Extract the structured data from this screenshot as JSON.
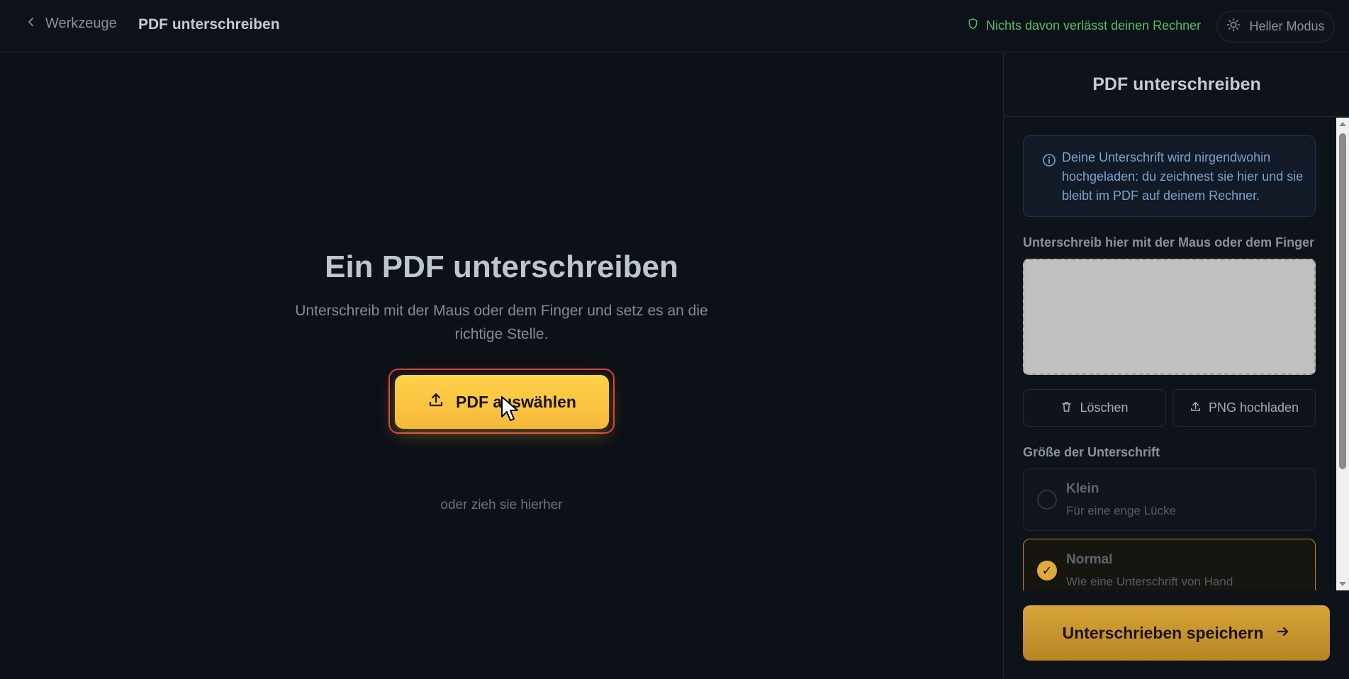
{
  "header": {
    "back_label": "Werkzeuge",
    "title": "PDF unterschreiben",
    "privacy_note": "Nichts davon verlässt deinen Rechner",
    "theme_toggle_label": "Heller Modus"
  },
  "main": {
    "title": "Ein PDF unterschreiben",
    "subtitle": "Unterschreib mit der Maus oder dem Finger und setz es an die richtige Stelle.",
    "pick_button_label": "PDF auswählen",
    "drop_hint": "oder zieh sie hierher"
  },
  "panel": {
    "title": "PDF unterschreiben",
    "info_text": "Deine Unterschrift wird nirgendwohin hochgeladen: du zeichnest sie hier und sie bleibt im PDF auf deinem Rechner.",
    "signature_label": "Unterschreib hier mit der Maus oder dem Finger",
    "clear_label": "Löschen",
    "upload_png_label": "PNG hochladen",
    "size_label": "Größe der Unterschrift",
    "size_options": [
      {
        "name": "Klein",
        "description": "Für eine enge Lücke",
        "selected": false
      },
      {
        "name": "Normal",
        "description": "Wie eine Unterschrift von Hand",
        "selected": true
      }
    ],
    "selected_mark": "✓",
    "save_label": "Unterschrieben speichern"
  },
  "colors": {
    "accent": "#f6b93a",
    "privacy_green": "#4fc06a",
    "highlight_border": "#e23c3c"
  },
  "icons": {
    "back": "chevron-left-icon",
    "shield": "shield-icon",
    "sun": "sun-icon",
    "upload": "upload-icon",
    "info": "info-icon",
    "trash": "trash-icon",
    "arrow": "arrow-right-icon"
  }
}
